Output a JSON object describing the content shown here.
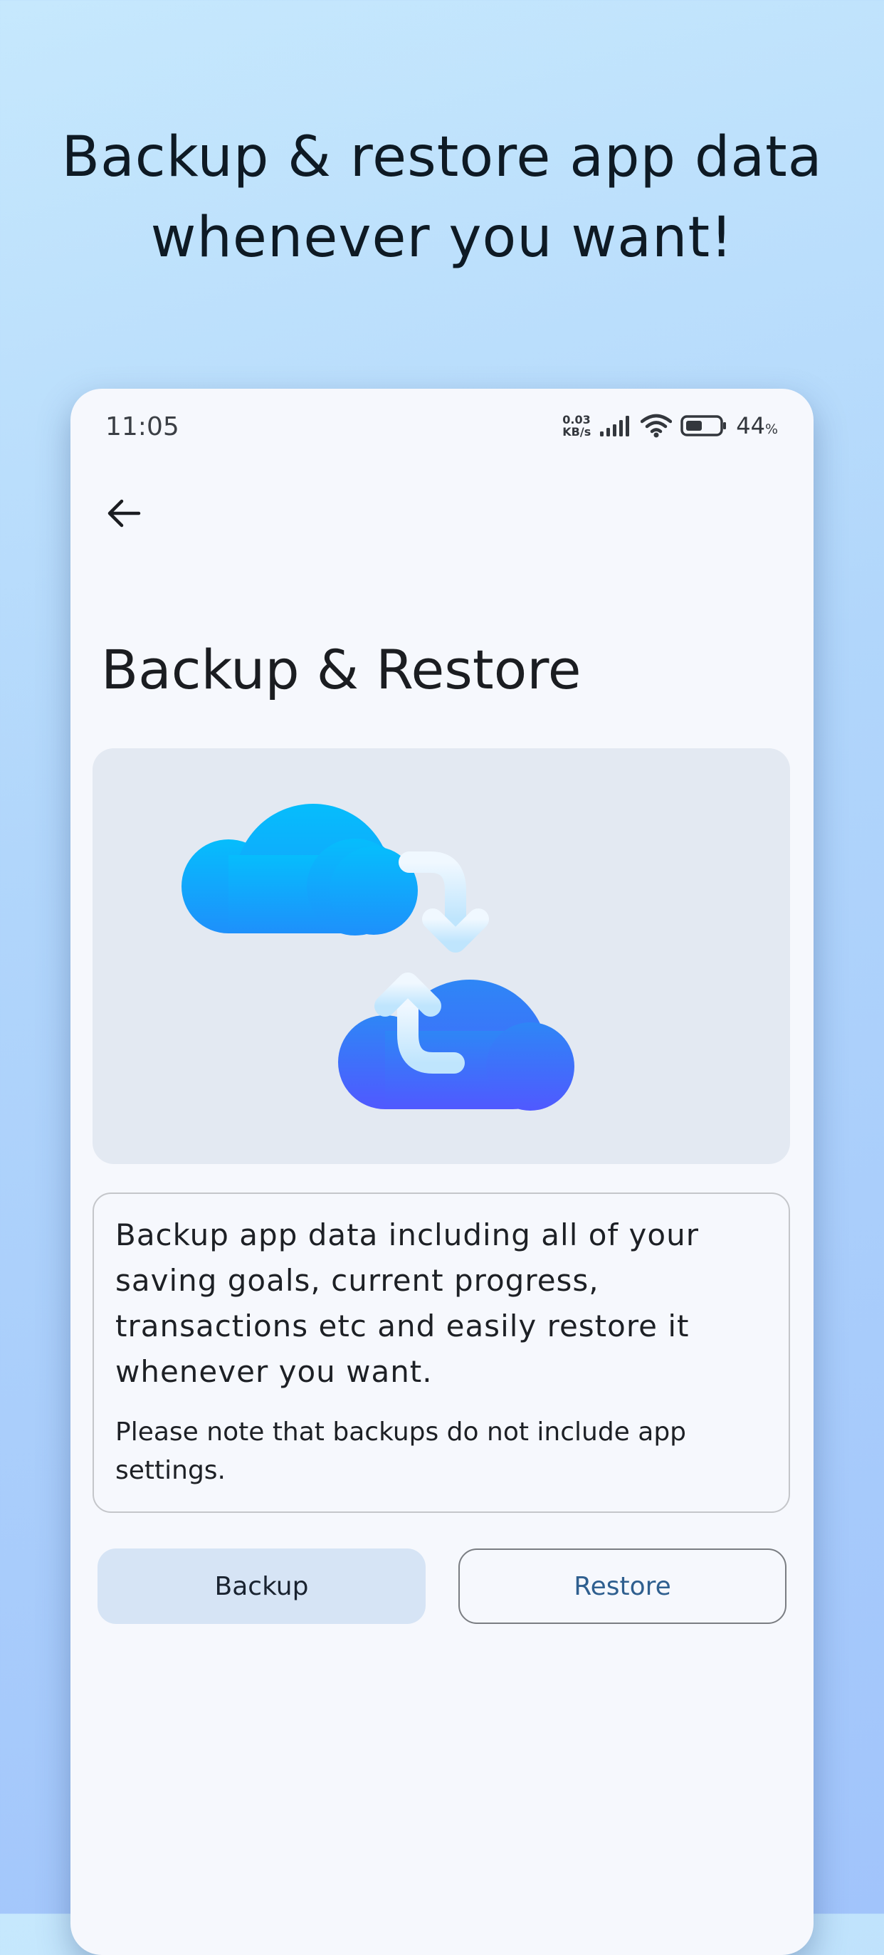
{
  "headline": {
    "line1": "Backup & restore app data",
    "line2": "whenever you want!"
  },
  "status_bar": {
    "time": "11:05",
    "net_speed_value": "0.03",
    "net_speed_unit": "KB/s",
    "battery_percent": "44",
    "battery_symbol": "%",
    "icons": [
      "signal-icon",
      "wifi-icon",
      "battery-icon"
    ]
  },
  "toolbar": {
    "back_icon": "arrow-left-icon"
  },
  "page": {
    "title": "Backup & Restore"
  },
  "illustration": {
    "icons": [
      "cloud-icon",
      "cloud-icon",
      "sync-arrow-icon",
      "sync-arrow-icon"
    ]
  },
  "info": {
    "main": "Backup app data including all of your saving goals, current progress, transactions etc and easily restore it whenever you want.",
    "note": "Please note that backups do not include app settings."
  },
  "actions": {
    "backup_label": "Backup",
    "restore_label": "Restore"
  },
  "colors": {
    "background_top": "#c6e8fd",
    "background_bottom": "#a1c4fb",
    "surface": "#f6f8fd",
    "illustration_bg": "#e3e9f2",
    "cloud_light": "#06bdfc",
    "cloud_dark": "#5059ff",
    "backup_button": "#d6e4f5",
    "restore_text": "#2f5f8f"
  }
}
